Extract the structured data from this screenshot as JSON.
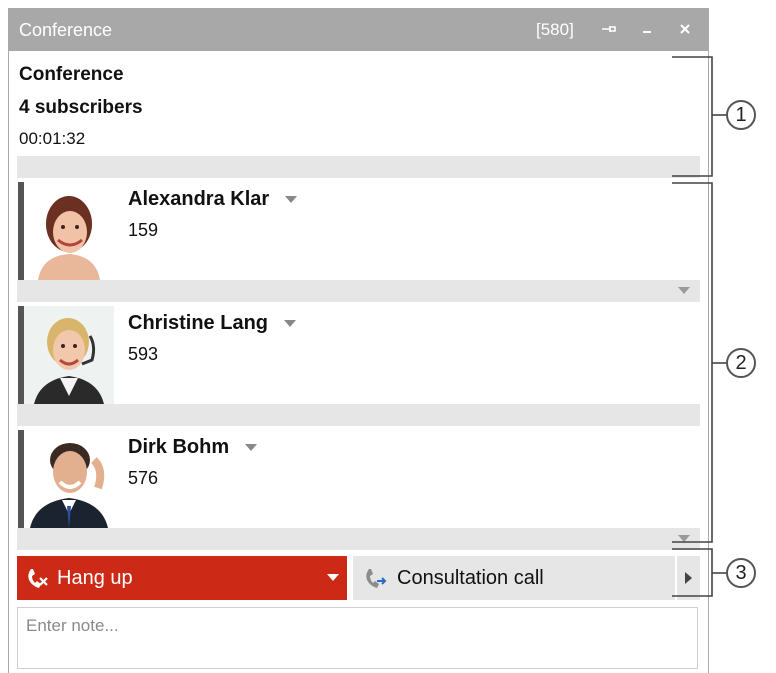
{
  "window": {
    "title": "Conference",
    "count": "[580]",
    "pin_icon": "pin-icon",
    "minimize_icon": "minimize-icon",
    "close_icon": "close-icon"
  },
  "conference": {
    "title": "Conference",
    "subscribers": "4 subscribers",
    "duration": "00:01:32"
  },
  "participants": [
    {
      "name": "Alexandra Klar",
      "extension": "159"
    },
    {
      "name": "Christine Lang",
      "extension": "593"
    },
    {
      "name": "Dirk Bohm",
      "extension": "576"
    }
  ],
  "actions": {
    "hang_up_label": "Hang up",
    "consultation_label": "Consultation call",
    "hang_up_color": "#cc2a16"
  },
  "note": {
    "placeholder": "Enter note..."
  },
  "callouts": [
    "1",
    "2",
    "3"
  ]
}
